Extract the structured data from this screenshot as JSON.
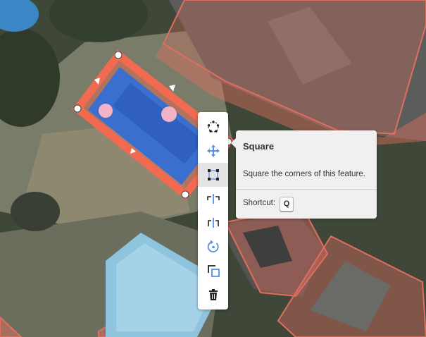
{
  "edit_menu": {
    "items": [
      {
        "name": "circularize",
        "icon": "circularize-icon"
      },
      {
        "name": "move",
        "icon": "move-icon"
      },
      {
        "name": "square",
        "icon": "square-corners-icon",
        "active": true
      },
      {
        "name": "reflect-long",
        "icon": "reflect-long-icon"
      },
      {
        "name": "reflect-short",
        "icon": "reflect-short-icon"
      },
      {
        "name": "rotate",
        "icon": "rotate-icon"
      },
      {
        "name": "extract",
        "icon": "extract-icon"
      },
      {
        "name": "delete",
        "icon": "trash-icon"
      }
    ]
  },
  "tooltip": {
    "title": "Square",
    "description": "Square the corners of this feature.",
    "shortcut_label": "Shortcut:",
    "shortcut_key": "Q"
  },
  "colors": {
    "selected_feature": "#f26a4f",
    "building_outline": "#e06e5f",
    "icon_blue": "#5a8de8",
    "icon_dark": "#222222"
  }
}
